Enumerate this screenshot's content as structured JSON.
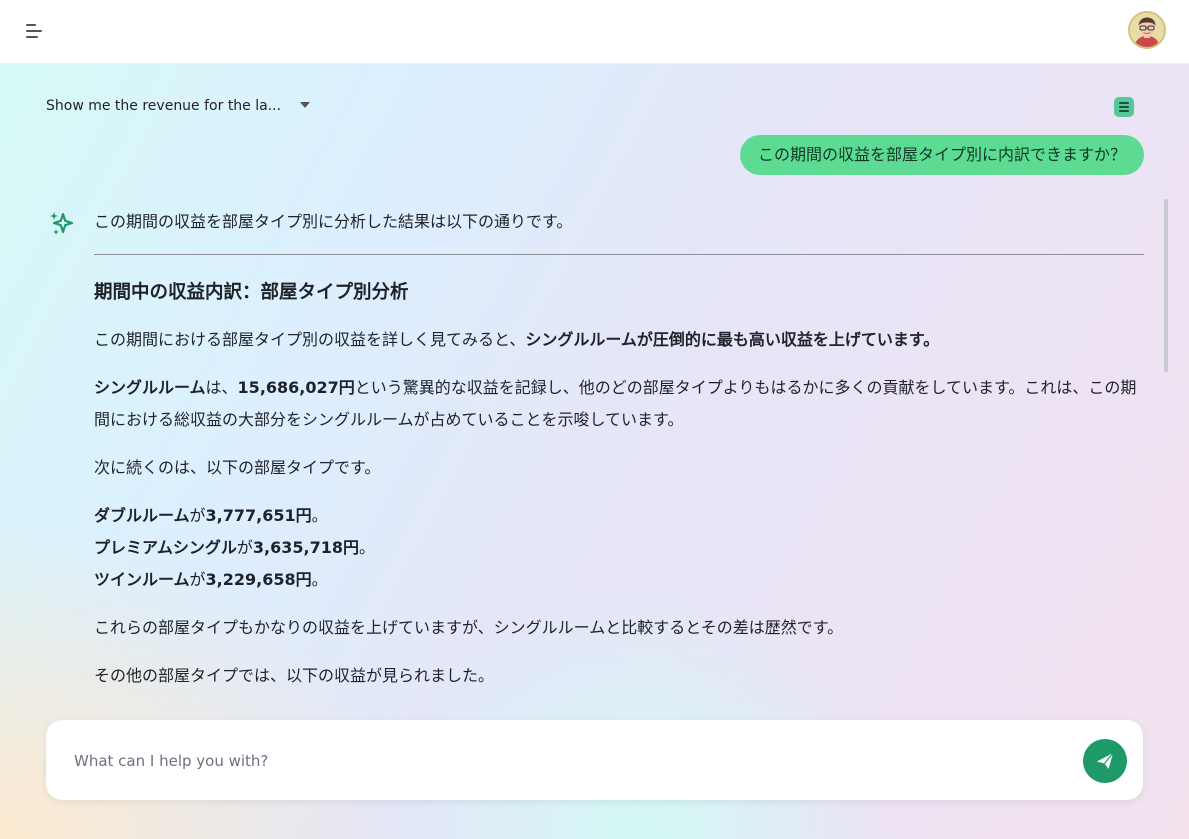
{
  "colors": {
    "accent_green": "#5ddb93",
    "send_button": "#1e9968",
    "sparkle": "#1e9968"
  },
  "header": {
    "menu_icon": "menu-icon",
    "avatar_icon": "user-avatar"
  },
  "conversation": {
    "selected_title": "Show me the revenue for the la...",
    "dropdown_icon": "caret-down-icon",
    "document_icon": "document-icon"
  },
  "user_message": "この期間の収益を部屋タイプ別に内訳できますか？",
  "assistant": {
    "icon": "sparkle-icon",
    "intro": "この期間の収益を部屋タイプ別に分析した結果は以下の通りです。",
    "heading": "期間中の収益内訳：部屋タイプ別分析",
    "p1_text": "この期間における部屋タイプ別の収益を詳しく見てみると、",
    "p1_bold": "シングルルームが圧倒的に最も高い収益を上げています。",
    "p2_bold1": "シングルルーム",
    "p2_text1": "は、",
    "p2_bold2": "15,686,027円",
    "p2_text2": "という驚異的な収益を記録し、他のどの部屋タイプよりもはるかに多くの貢献をしています。これは、この期間における総収益の大部分をシングルルームが占めていることを示唆しています。",
    "p3": "次に続くのは、以下の部屋タイプです。",
    "list": [
      {
        "name": "ダブルルーム",
        "joiner": "が",
        "amount": "3,777,651円",
        "end": "。"
      },
      {
        "name": "プレミアムシングル",
        "joiner": "が",
        "amount": "3,635,718円",
        "end": "。"
      },
      {
        "name": "ツインルーム",
        "joiner": "が",
        "amount": "3,229,658円",
        "end": "。"
      }
    ],
    "p4": "これらの部屋タイプもかなりの収益を上げていますが、シングルルームと比較するとその差は歴然です。",
    "p5": "その他の部屋タイプでは、以下の収益が見られました。"
  },
  "composer": {
    "placeholder": "What can I help you with?",
    "send_icon": "send-icon"
  }
}
